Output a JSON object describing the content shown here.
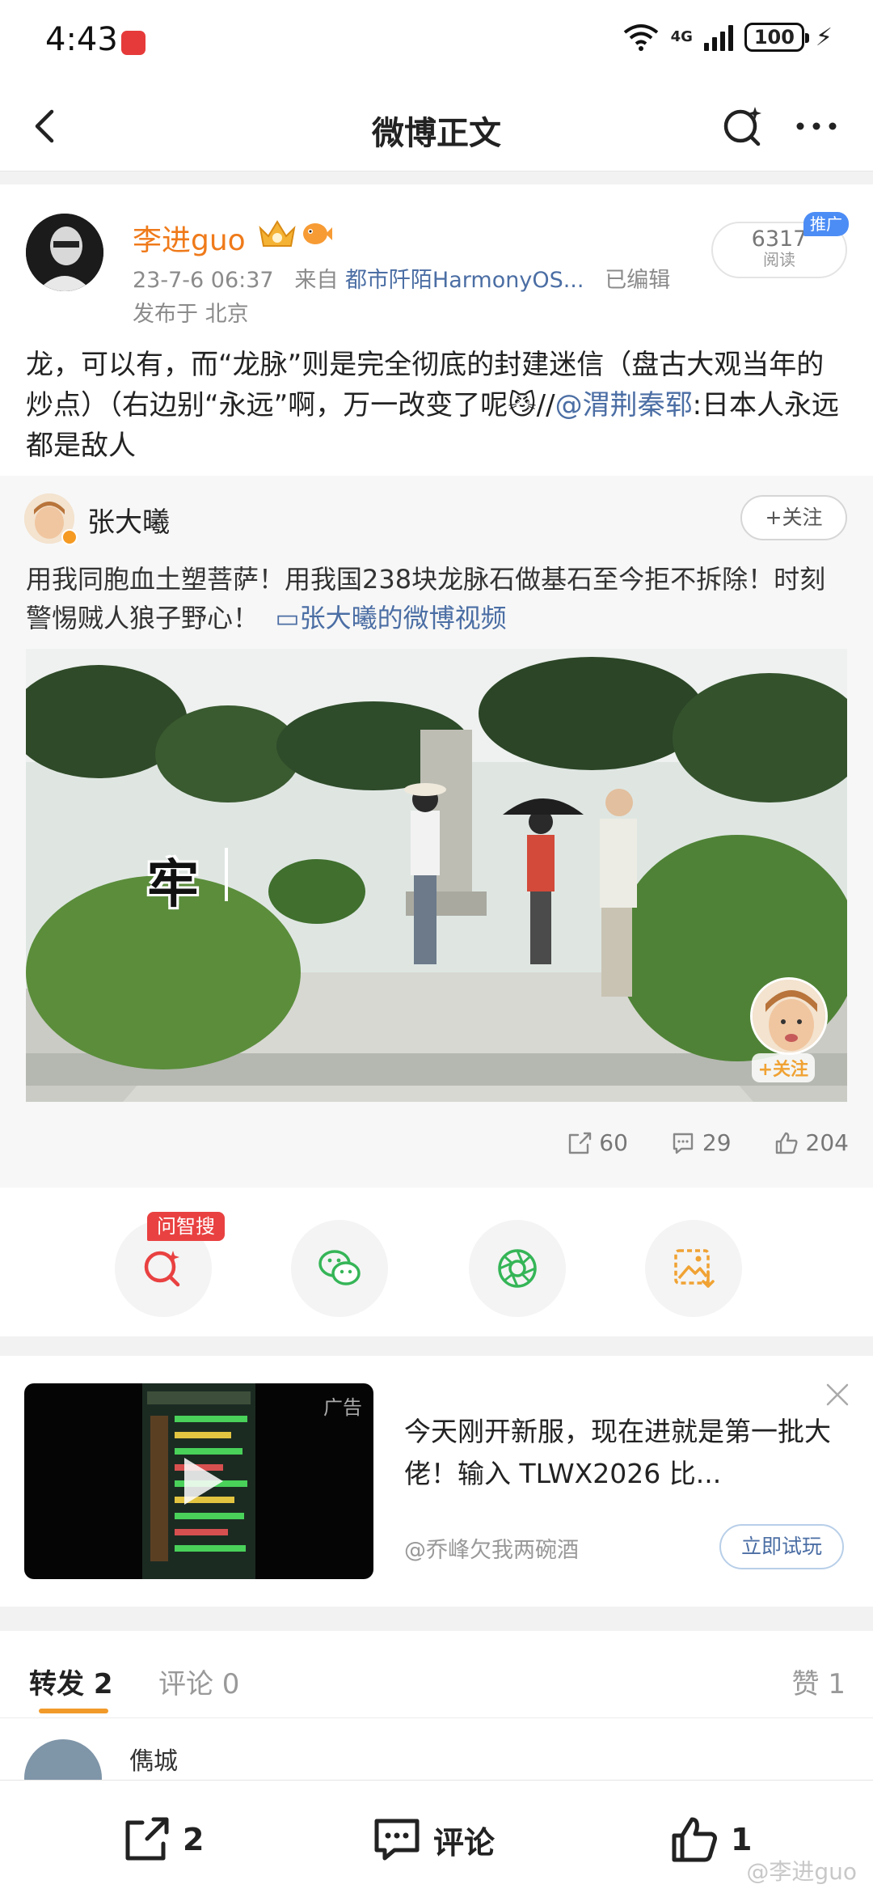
{
  "status": {
    "time": "4:43",
    "network": "4G",
    "battery": "100"
  },
  "nav": {
    "title": "微博正文"
  },
  "post": {
    "username": "李进guo",
    "timestamp": "23-7-6 06:37",
    "source_prefix": "来自",
    "source": "都市阡陌HarmonyOS...",
    "edited": "已编辑",
    "location": "发布于 北京",
    "reads_count": "6317",
    "reads_label": "阅读",
    "promo_tag": "推广",
    "text": "龙，可以有，而“龙脉”则是完全彻底的封建迷信（盘古大观当年的炒点）（右边别“永远”啊，万一改变了呢😼//",
    "mention": "@渭荆秦郓",
    "text_tail": ":日本人永远都是敌人"
  },
  "retweet": {
    "name": "张大曦",
    "follow_label": "+关注",
    "text": "用我同胞血土塑菩萨！用我国238块龙脉石做基石至今拒不拆除！时刻警惕贼人狼子野心！",
    "video_link": "张大曦的微博视频",
    "video_overlay_char": "牢",
    "video_follow": "+关注",
    "reposts": "60",
    "comments": "29",
    "likes": "204"
  },
  "share": {
    "ai_tag": "问智搜"
  },
  "ad": {
    "label": "广告",
    "text": "今天刚开新服，现在进就是第一批大佬！输入 TLWX2026 比...",
    "source": "@乔峰欠我两碗酒",
    "cta": "立即试玩"
  },
  "tabs": {
    "repost": "转发 2",
    "comment": "评论 0",
    "like": "赞 1"
  },
  "first_repost": {
    "name": "儁城"
  },
  "bottom": {
    "repost_count": "2",
    "comment_label": "评论",
    "like_count": "1"
  },
  "watermark": "@李进guo",
  "colors": {
    "accent": "#f19a2a",
    "link": "#4b6ea4",
    "username": "#ef7a1a",
    "ai_tag": "#e94141"
  },
  "icons": [
    "back-icon",
    "search-ai-icon",
    "more-icon",
    "vip-crown-icon",
    "fish-icon",
    "repost-icon",
    "comment-icon",
    "like-icon",
    "wechat-icon",
    "moments-icon",
    "save-image-icon",
    "play-icon",
    "close-icon"
  ]
}
